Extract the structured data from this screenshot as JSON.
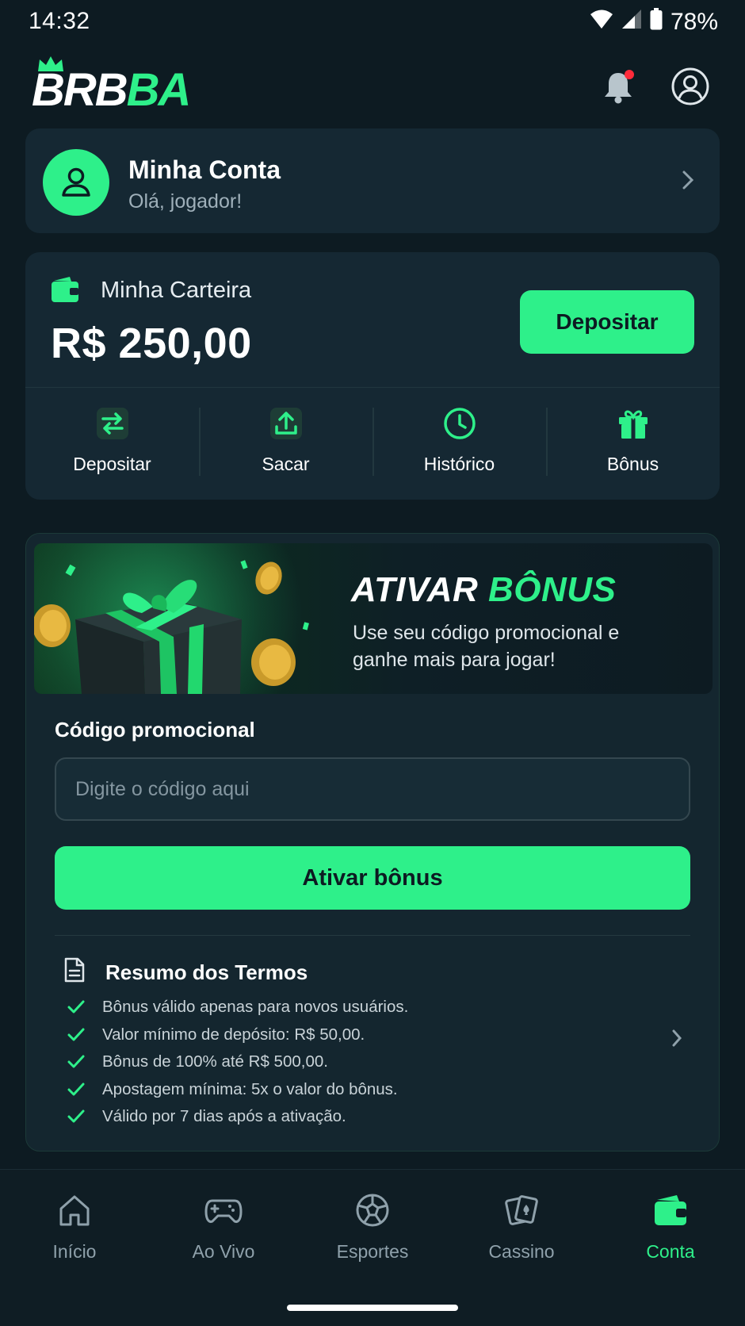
{
  "status_bar": {
    "time": "14:32",
    "battery": "78%"
  },
  "header": {
    "logo_white": "BRB",
    "logo_green": "BA"
  },
  "account": {
    "title": "Minha Conta",
    "subtitle": "Olá, jogador!"
  },
  "wallet": {
    "title": "Minha Carteira",
    "balance": "R$ 250,00",
    "deposit_label": "Depositar",
    "quick_actions": [
      {
        "label": "Depositar",
        "icon": "transfer-icon"
      },
      {
        "label": "Sacar",
        "icon": "upload-icon"
      },
      {
        "label": "Histórico",
        "icon": "clock-icon"
      },
      {
        "label": "Bônus",
        "icon": "gift-icon"
      }
    ]
  },
  "bonus": {
    "banner_title_white": "ATIVAR",
    "banner_title_green": "BÔNUS",
    "banner_subtitle": "Use seu código promocional e ganhe mais para jogar!",
    "promo_label": "Código promocional",
    "promo_placeholder": "Digite o código aqui",
    "promo_value": "",
    "activate_label": "Ativar bônus",
    "terms_title": "Resumo dos Termos",
    "terms": [
      "Bônus válido apenas para novos usuários.",
      "Valor mínimo de depósito: R$ 50,00.",
      "Bônus de 100% até R$ 500,00.",
      "Apostagem mínima: 5x o valor do bônus.",
      "Válido por 7 dias após a ativação."
    ]
  },
  "nav": {
    "items": [
      {
        "label": "Início",
        "icon": "home-icon"
      },
      {
        "label": "Ao Vivo",
        "icon": "gamepad-icon"
      },
      {
        "label": "Esportes",
        "icon": "ball-icon"
      },
      {
        "label": "Cassino",
        "icon": "cards-icon"
      },
      {
        "label": "Conta",
        "icon": "wallet-icon"
      }
    ],
    "active": "Conta"
  },
  "colors": {
    "accent": "#2ef08a",
    "background": "#0d1b22",
    "card": "#152833",
    "notification": "#ff2b3a"
  }
}
